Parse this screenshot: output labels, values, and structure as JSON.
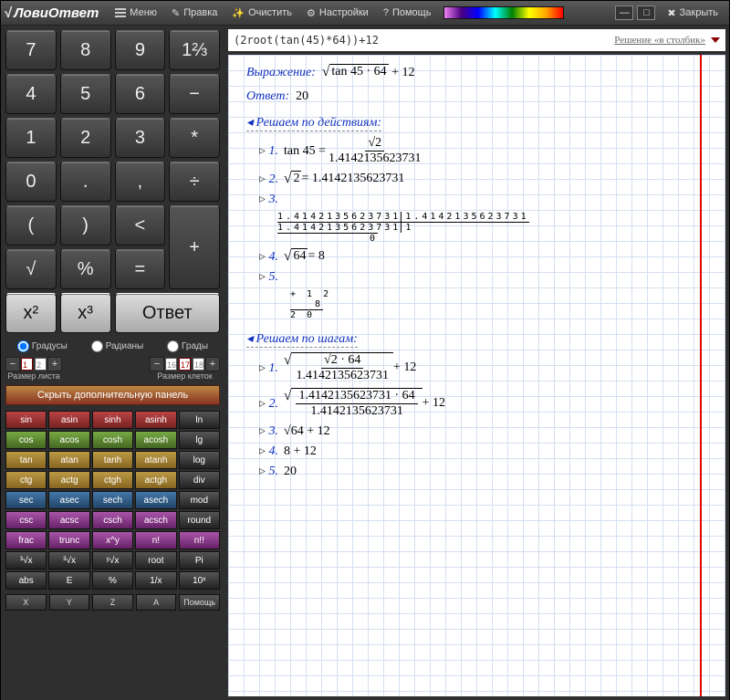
{
  "app": {
    "name": "ЛовиОтвет"
  },
  "menubar": {
    "menu": "Меню",
    "edit": "Правка",
    "clear": "Очистить",
    "settings": "Настройки",
    "help": "Помощь",
    "close": "Закрыть"
  },
  "keypad": [
    "7",
    "8",
    "9",
    "1⅔",
    "4",
    "5",
    "6",
    "−",
    "1",
    "2",
    "3",
    "*",
    "0",
    ".",
    ",",
    "÷",
    "(",
    ")",
    "<",
    "+",
    "√",
    "%",
    "=",
    "",
    "x²",
    "x³",
    "Ответ",
    ""
  ],
  "modes": {
    "deg": "Градусы",
    "rad": "Радианы",
    "grad": "Грады",
    "selected": "deg"
  },
  "sheet": {
    "label": "Размер листа",
    "pages": [
      "1",
      "2"
    ],
    "cur": "1"
  },
  "cells": {
    "label": "Размер клеток",
    "pages": [
      "16",
      "17",
      "18"
    ],
    "cur": "17"
  },
  "hide_panel": "Скрыть дополнительную панель",
  "fns": [
    [
      "sin",
      "asin",
      "sinh",
      "asinh",
      "ln"
    ],
    [
      "cos",
      "acos",
      "cosh",
      "acosh",
      "lg"
    ],
    [
      "tan",
      "atan",
      "tanh",
      "atanh",
      "log"
    ],
    [
      "ctg",
      "actg",
      "ctgh",
      "actgh",
      "div"
    ],
    [
      "sec",
      "asec",
      "sech",
      "asech",
      "mod"
    ],
    [
      "csc",
      "acsc",
      "csch",
      "acsch",
      "round"
    ],
    [
      "frac",
      "trunc",
      "x^y",
      "n!",
      "n!!"
    ],
    [
      "³√x",
      "³√x",
      "ʸ√x",
      "root",
      "Pi"
    ],
    [
      "abs",
      "E",
      "%",
      "1/x",
      "10ˣ"
    ]
  ],
  "fn_colors": [
    "c-r",
    "c-g",
    "c-y",
    "c-b",
    "c-p",
    "c-k",
    "c-k",
    "c-k",
    "c-k"
  ],
  "fn_col4_colors": [
    "c-k",
    "c-k",
    "c-k",
    "c-k",
    "c-k",
    "c-k",
    "c-k",
    "c-k",
    "c-k"
  ],
  "bottom": [
    "X",
    "Y",
    "Z",
    "A",
    "Помощь"
  ],
  "expr": {
    "input": "(2root(tan(45)*64))+12",
    "mode": "Решение «в столбик»"
  },
  "sol": {
    "vyr": "Выражение:",
    "ans_lbl": "Ответ:",
    "ans": "20",
    "by_actions": "Решаем по действиям:",
    "by_steps": "Решаем по шагам:",
    "a1": "tan 45 =",
    "a1n": "√2",
    "a1d": "1.4142135623731",
    "a2": "√2",
    "a2r": " = 1.4142135623731",
    "a3": "3.",
    "div_top": "1.4142135623731",
    "div_bot": "1.4142135623731",
    "div_q": "1.4142135623731",
    "div_r": "0",
    "a4": "√64",
    "a4r": " = 8",
    "a5": "5.",
    "col_a": "+ 1 2",
    "col_b": "    8",
    "col_s": "  2 0",
    "s1_up": "√2 · 64",
    "s1_dn": "1.4142135623731",
    "s1_tail": " + 12",
    "s2_up": "1.4142135623731 · 64",
    "s2_dn": "1.4142135623731",
    "s2_tail": " + 12",
    "s3": "√64 + 12",
    "s4": "8 + 12",
    "s5": "20"
  }
}
